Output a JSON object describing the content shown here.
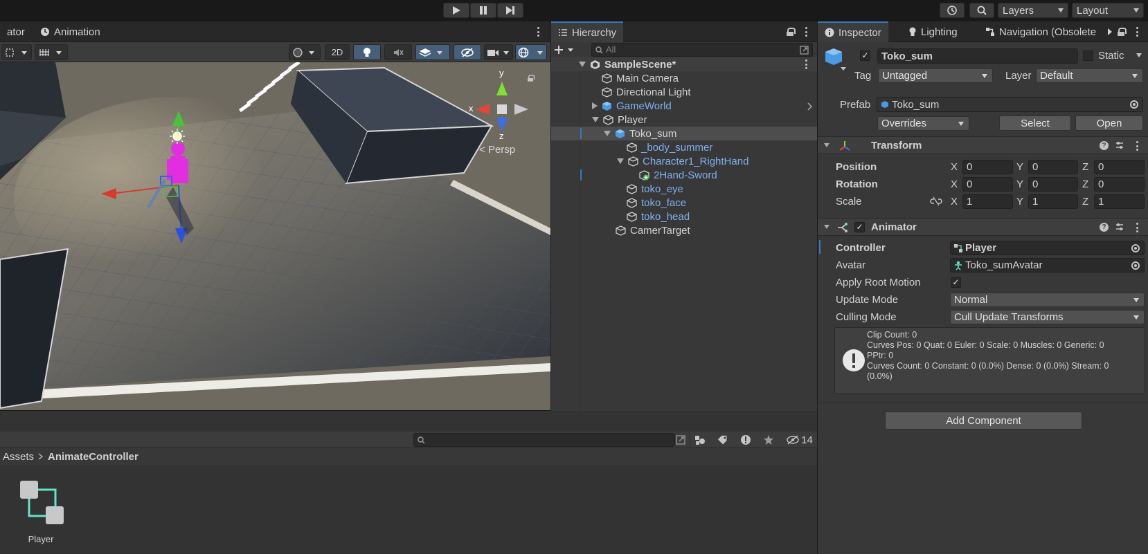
{
  "top_toolbar": {
    "play_icon": "play-icon",
    "pause_icon": "pause-icon",
    "step_icon": "step-icon",
    "history_icon": "history-icon",
    "search_icon": "search-icon",
    "layers_label": "Layers",
    "layout_label": "Layout"
  },
  "scene_panel": {
    "tabs": [
      {
        "label": "ator"
      },
      {
        "label": "Animation"
      }
    ],
    "toolbar": {
      "mode_2d_label": "2D"
    },
    "gizmo": {
      "axis_y": "y",
      "axis_x": "x",
      "axis_z": "z",
      "projection_label": "Persp"
    }
  },
  "hierarchy": {
    "tab_label": "Hierarchy",
    "search_placeholder": "All",
    "scene_name": "SampleScene*",
    "items": [
      {
        "label": "Main Camera"
      },
      {
        "label": "Directional Light"
      },
      {
        "label": "GameWorld"
      },
      {
        "label": "Player"
      },
      {
        "label": "Toko_sum"
      },
      {
        "label": "_body_summer"
      },
      {
        "label": "Character1_RightHand"
      },
      {
        "label": "2Hand-Sword"
      },
      {
        "label": "toko_eye"
      },
      {
        "label": "toko_face"
      },
      {
        "label": "toko_head"
      },
      {
        "label": "CamerTarget"
      }
    ]
  },
  "inspector": {
    "tabs": [
      {
        "label": "Inspector"
      },
      {
        "label": "Lighting"
      },
      {
        "label": "Navigation (Obsolete"
      }
    ],
    "object_name": "Toko_sum",
    "static_label": "Static",
    "tag_label": "Tag",
    "tag_value": "Untagged",
    "layer_label": "Layer",
    "layer_value": "Default",
    "prefab_label": "Prefab",
    "prefab_value": "Toko_sum",
    "overrides_label": "Overrides",
    "select_label": "Select",
    "open_label": "Open",
    "transform": {
      "title": "Transform",
      "position_label": "Position",
      "rotation_label": "Rotation",
      "scale_label": "Scale",
      "axis_x": "X",
      "axis_y": "Y",
      "axis_z": "Z",
      "position": {
        "x": "0",
        "y": "0",
        "z": "0"
      },
      "rotation": {
        "x": "0",
        "y": "0",
        "z": "0"
      },
      "scale": {
        "x": "1",
        "y": "1",
        "z": "1"
      }
    },
    "animator": {
      "title": "Animator",
      "controller_label": "Controller",
      "controller_value": "Player",
      "avatar_label": "Avatar",
      "avatar_value": "Toko_sumAvatar",
      "apply_root_motion_label": "Apply Root Motion",
      "update_mode_label": "Update Mode",
      "update_mode_value": "Normal",
      "culling_mode_label": "Culling Mode",
      "culling_mode_value": "Cull Update Transforms",
      "info": {
        "clip_count": "Clip Count: 0",
        "curves_pos": "Curves Pos: 0 Quat: 0 Euler: 0 Scale: 0 Muscles: 0 Generic: 0",
        "pptr": "PPtr: 0",
        "curves_count": "Curves Count: 0 Constant: 0 (0.0%) Dense: 0 (0.0%) Stream: 0",
        "stream_pct": "(0.0%)"
      }
    },
    "add_component_label": "Add Component"
  },
  "project": {
    "breadcrumb_root": "Assets",
    "breadcrumb_current": "AnimateController",
    "hidden_count": "14",
    "assets": [
      {
        "label": "Player"
      }
    ]
  },
  "colors": {
    "accent_blue": "#3a79bb",
    "prefab_blue": "#7fb0ef",
    "panel_bg": "#383838"
  }
}
